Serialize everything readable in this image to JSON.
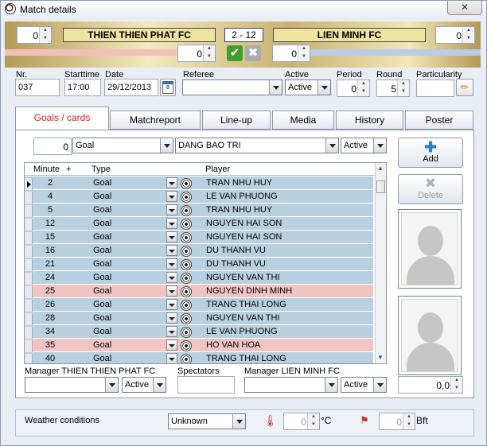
{
  "window": {
    "title": "Match details",
    "close_label": "✕"
  },
  "score": {
    "home_extra": "0",
    "home_team": "THIEN THIEN PHAT FC",
    "result": "2  - 12",
    "away_team": "LIEN MINH FC",
    "away_extra": "0",
    "home_pen": "0",
    "away_pen": "0"
  },
  "details": {
    "nr_label": "Nr.",
    "nr": "037",
    "starttime_label": "Starttime",
    "starttime": "17:00",
    "date_label": "Date",
    "date": "29/12/2013",
    "referee_label": "Referee",
    "referee": "",
    "active_label": "Active",
    "active": "Active",
    "period_label": "Period",
    "period": "0",
    "round_label": "Round",
    "round": "5",
    "particularity_label": "Particularity",
    "particularity": ""
  },
  "tabs": [
    "Goals / cards",
    "Matchreport",
    "Line-up",
    "Media",
    "History",
    "Poster"
  ],
  "entry": {
    "minute": "0",
    "type": "Goal",
    "player": "DANG BAO TRI",
    "status": "Active"
  },
  "grid": {
    "headers": {
      "minute": "Minute",
      "plus": "+",
      "type": "Type",
      "player": "Player"
    },
    "rows": [
      {
        "minute": "2",
        "type": "Goal",
        "player": "TRAN NHU HUY",
        "highlight": false
      },
      {
        "minute": "4",
        "type": "Goal",
        "player": "LE VAN PHUONG",
        "highlight": false
      },
      {
        "minute": "5",
        "type": "Goal",
        "player": "TRAN NHU HUY",
        "highlight": false
      },
      {
        "minute": "12",
        "type": "Goal",
        "player": "NGUYEN HAI SON",
        "highlight": false
      },
      {
        "minute": "15",
        "type": "Goal",
        "player": "NGUYEN HAI SON",
        "highlight": false
      },
      {
        "minute": "16",
        "type": "Goal",
        "player": "DU THANH VU",
        "highlight": false
      },
      {
        "minute": "21",
        "type": "Goal",
        "player": "DU THANH VU",
        "highlight": false
      },
      {
        "minute": "24",
        "type": "Goal",
        "player": "NGUYEN VAN THI",
        "highlight": false
      },
      {
        "minute": "25",
        "type": "Goal",
        "player": "NGUYEN DINH MINH",
        "highlight": true
      },
      {
        "minute": "26",
        "type": "Goal",
        "player": "TRANG THAI LONG",
        "highlight": false
      },
      {
        "minute": "28",
        "type": "Goal",
        "player": "NGUYEN VAN THI",
        "highlight": false
      },
      {
        "minute": "34",
        "type": "Goal",
        "player": "LE VAN PHUONG",
        "highlight": false
      },
      {
        "minute": "35",
        "type": "Goal",
        "player": "HO VAN HOA",
        "highlight": true
      },
      {
        "minute": "40",
        "type": "Goal",
        "player": "TRANG THAI LONG",
        "highlight": false
      }
    ]
  },
  "buttons": {
    "add": "Add",
    "delete": "Delete"
  },
  "managers": {
    "home_label": "Manager THIEN THIEN PHAT FC",
    "home": "",
    "home_status": "Active",
    "spectators_label": "Spectators",
    "spectators": "",
    "away_label": "Manager LIEN MINH FC",
    "away": "",
    "away_status": "Active",
    "rating": "0,0"
  },
  "weather": {
    "label": "Weather conditions",
    "condition": "Unknown",
    "temp": "0",
    "temp_unit": "°C",
    "wind": "0",
    "wind_unit": "Bft"
  },
  "colors": {
    "row_normal": "#b8d0e0",
    "row_highlight": "#f0c4c0",
    "team_box": "#efe3a0",
    "active_tab": "#d62020"
  }
}
